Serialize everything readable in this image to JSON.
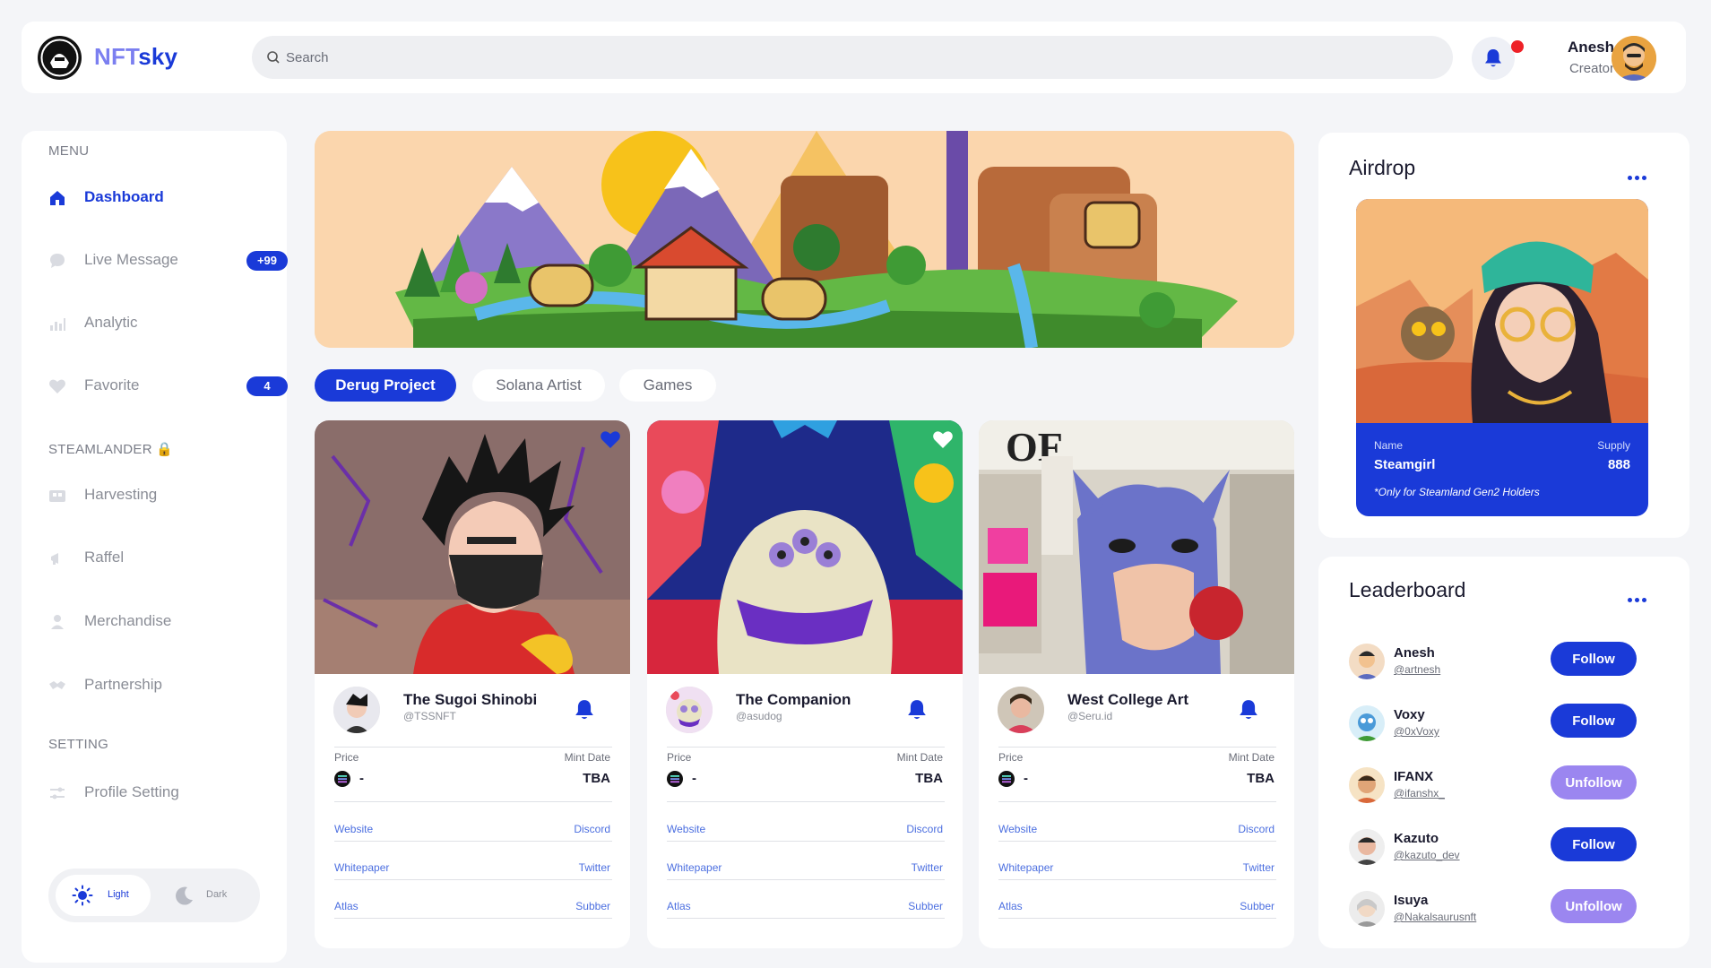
{
  "app": {
    "brand_part1": "NFT",
    "brand_part2": "sky"
  },
  "header": {
    "search_placeholder": "Search",
    "user_name": "Anesh",
    "user_role": "Creator"
  },
  "sidebar": {
    "menu_title": "MENU",
    "items": [
      {
        "label": "Dashboard",
        "icon": "home-icon",
        "active": true
      },
      {
        "label": "Live Message",
        "icon": "chat-icon",
        "badge": "+99"
      },
      {
        "label": "Analytic",
        "icon": "bar-chart-icon"
      },
      {
        "label": "Favorite",
        "icon": "heart-icon",
        "badge": "4"
      }
    ],
    "steam_title": "STEAMLANDER 🔒",
    "steam_items": [
      {
        "label": "Harvesting",
        "icon": "harvest-icon"
      },
      {
        "label": "Raffel",
        "icon": "megaphone-icon"
      },
      {
        "label": "Merchandise",
        "icon": "user-icon"
      },
      {
        "label": "Partnership",
        "icon": "handshake-icon"
      }
    ],
    "setting_title": "SETTING",
    "setting_items": [
      {
        "label": "Profile Setting",
        "icon": "sliders-icon"
      }
    ],
    "theme": {
      "light": "Light",
      "dark": "Dark"
    }
  },
  "tabs": [
    "Derug Project",
    "Solana Artist",
    "Games"
  ],
  "cards": [
    {
      "title": "The Sugoi Shinobi",
      "handle": "@TSSNFT",
      "price_label": "Price",
      "price": "-",
      "mint_label": "Mint Date",
      "mint": "TBA",
      "links": [
        [
          "Website",
          "Discord"
        ],
        [
          "Whitepaper",
          "Twitter"
        ],
        [
          "Atlas",
          "Subber"
        ]
      ]
    },
    {
      "title": "The Companion",
      "handle": "@asudog",
      "price_label": "Price",
      "price": "-",
      "mint_label": "Mint Date",
      "mint": "TBA",
      "links": [
        [
          "Website",
          "Discord"
        ],
        [
          "Whitepaper",
          "Twitter"
        ],
        [
          "Atlas",
          "Subber"
        ]
      ]
    },
    {
      "title": "West College Art",
      "handle": "@Seru.id",
      "price_label": "Price",
      "price": "-",
      "mint_label": "Mint Date",
      "mint": "TBA",
      "links": [
        [
          "Website",
          "Discord"
        ],
        [
          "Whitepaper",
          "Twitter"
        ],
        [
          "Atlas",
          "Subber"
        ]
      ]
    }
  ],
  "airdrop": {
    "title": "Airdrop",
    "name_label": "Name",
    "name": "Steamgirl",
    "supply_label": "Supply",
    "supply": "888",
    "note": "*Only for Steamland Gen2 Holders"
  },
  "leaderboard": {
    "title": "Leaderboard",
    "rows": [
      {
        "name": "Anesh",
        "handle": "@artnesh",
        "action": "Follow"
      },
      {
        "name": "Voxy",
        "handle": "@0xVoxy",
        "action": "Follow"
      },
      {
        "name": "IFANX",
        "handle": "@ifanshx_",
        "action": "Unfollow"
      },
      {
        "name": "Kazuto",
        "handle": "@kazuto_dev",
        "action": "Follow"
      },
      {
        "name": "Isuya",
        "handle": "@Nakalsaurusnft",
        "action": "Unfollow"
      }
    ]
  },
  "colors": {
    "accent": "#1a3ad8",
    "unfollow": "#9b86f0",
    "notification": "#ee2127"
  }
}
